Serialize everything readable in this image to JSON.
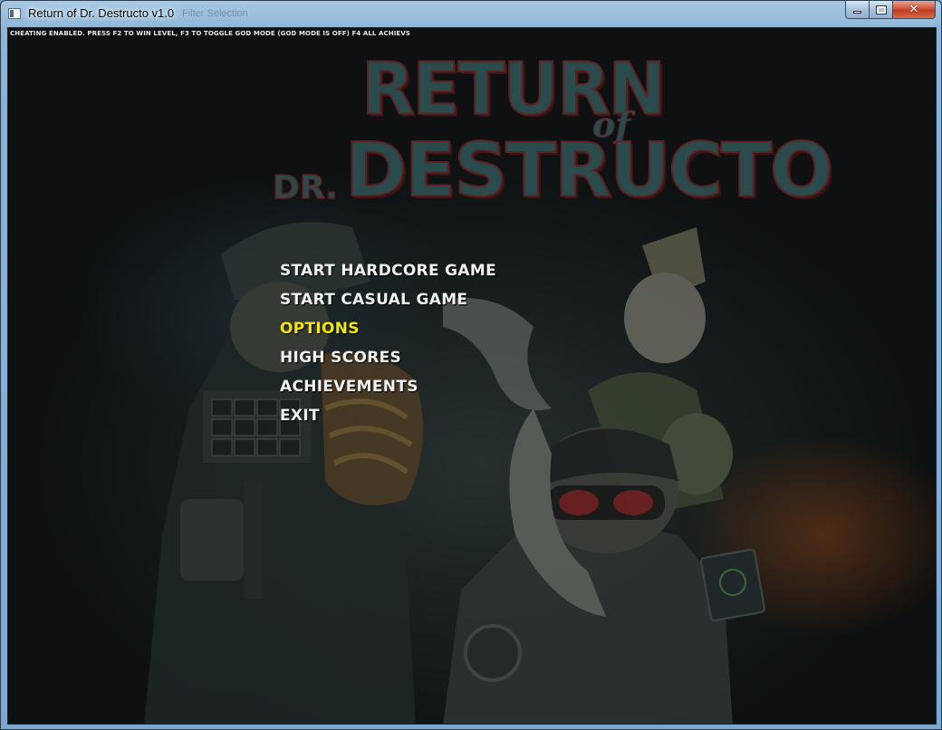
{
  "window": {
    "title": "Return of Dr. Destructo v1.0",
    "ghost_title": "Filter Selection",
    "close_glyph": "✕"
  },
  "game": {
    "cheat_notice": "CHEATING ENABLED. PRESS F2 TO WIN LEVEL, F3 TO TOGGLE GOD MODE (GOD MODE IS OFF) F4 ALL ACHIEVS",
    "logo": {
      "line1": "RETURN",
      "of": "of",
      "dr": "DR.",
      "line2": "DESTRUCTO"
    },
    "menu": {
      "items": [
        {
          "label": "START HARDCORE GAME",
          "selected": false
        },
        {
          "label": "START CASUAL GAME",
          "selected": false
        },
        {
          "label": "OPTIONS",
          "selected": true
        },
        {
          "label": "HIGH SCORES",
          "selected": false
        },
        {
          "label": "ACHIEVEMENTS",
          "selected": false
        },
        {
          "label": "EXIT",
          "selected": false
        }
      ]
    }
  },
  "colors": {
    "menu_text": "#f2f2f2",
    "menu_selected": "#f5e60a",
    "logo_fill": "#2a4a4c",
    "logo_outline": "#5a2222"
  }
}
